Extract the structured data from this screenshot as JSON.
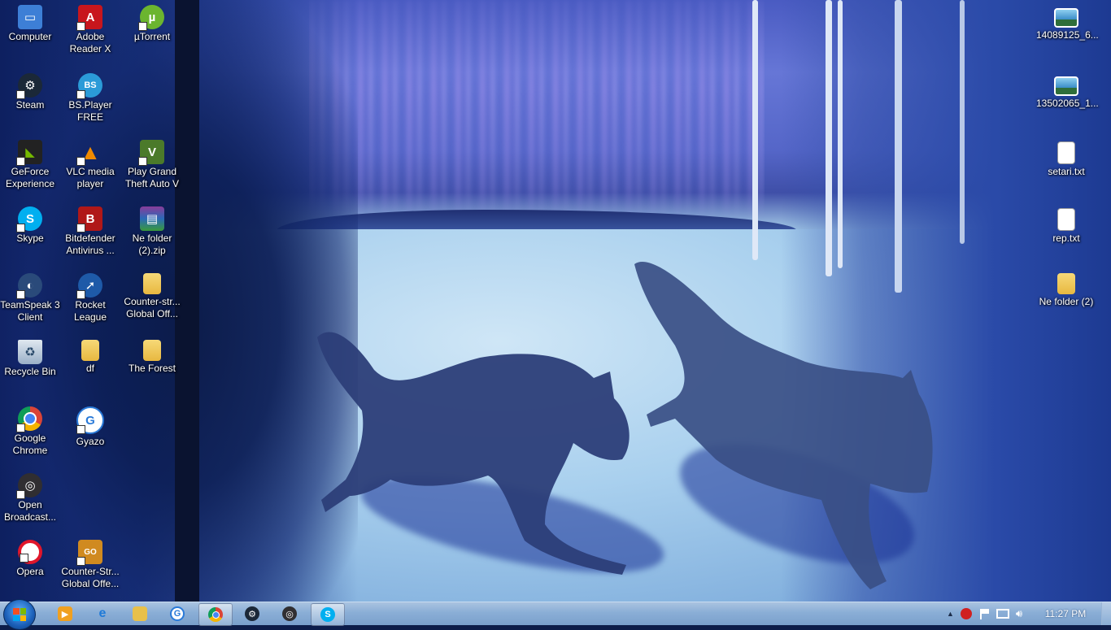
{
  "desktop": {
    "icons_left": [
      {
        "label": "Computer",
        "icon": "computer-icon",
        "color": "#3d7fd6"
      },
      {
        "label": "Adobe\nReader X",
        "icon": "adobe-reader-icon",
        "color": "#c8161d"
      },
      {
        "label": "µTorrent",
        "icon": "utorrent-icon",
        "color": "#6bb52f"
      },
      {
        "label": "Steam",
        "icon": "steam-icon",
        "color": "#1b2838"
      },
      {
        "label": "BS.Player\nFREE",
        "icon": "bsplayer-icon",
        "color": "#2b9bd8"
      },
      {
        "label": "GeForce\nExperience",
        "icon": "geforce-icon",
        "color": "#76b900"
      },
      {
        "label": "VLC media\nplayer",
        "icon": "vlc-icon",
        "color": "#f08a00"
      },
      {
        "label": "Play Grand\nTheft Auto V",
        "icon": "gta-icon",
        "color": "#4b7a2a"
      },
      {
        "label": "Skype",
        "icon": "skype-icon",
        "color": "#00aff0"
      },
      {
        "label": "Bitdefender\nAntivirus ...",
        "icon": "bitdefender-icon",
        "color": "#b01818"
      },
      {
        "label": "Ne folder\n(2).zip",
        "icon": "winrar-icon",
        "color": "#8a3d9a"
      },
      {
        "label": "TeamSpeak 3\nClient",
        "icon": "teamspeak-icon",
        "color": "#2a4a7a"
      },
      {
        "label": "Rocket\nLeague",
        "icon": "rocket-league-icon",
        "color": "#1e5aa8"
      },
      {
        "label": "Counter-str...\nGlobal Off...",
        "icon": "folder-icon",
        "color": "#f0c850"
      },
      {
        "label": "Recycle Bin",
        "icon": "recycle-bin-icon",
        "color": "#c0d0e0"
      },
      {
        "label": "df",
        "icon": "folder-icon",
        "color": "#f0c850"
      },
      {
        "label": "The Forest",
        "icon": "folder-icon",
        "color": "#f0c850"
      },
      {
        "label": "Google\nChrome",
        "icon": "chrome-icon",
        "color": "#4285f4"
      },
      {
        "label": "Gyazo",
        "icon": "gyazo-icon",
        "color": "#2a7ad8"
      },
      {
        "label": "Open\nBroadcast...",
        "icon": "obs-icon",
        "color": "#302e31"
      },
      {
        "label": "Opera",
        "icon": "opera-icon",
        "color": "#e0162b"
      },
      {
        "label": "Counter-Str...\nGlobal Offe...",
        "icon": "csgo-icon",
        "color": "#d08a20"
      }
    ],
    "icons_right": [
      {
        "label": "14089125_6...",
        "icon": "image-file-icon"
      },
      {
        "label": "13502065_1...",
        "icon": "image-file-icon"
      },
      {
        "label": "setari.txt",
        "icon": "text-file-icon"
      },
      {
        "label": "rep.txt",
        "icon": "text-file-icon"
      },
      {
        "label": "Ne folder (2)",
        "icon": "folder-icon"
      }
    ]
  },
  "taskbar": {
    "pinned": [
      {
        "name": "media-player-icon",
        "color": "#f0a020",
        "active": false
      },
      {
        "name": "internet-explorer-icon",
        "color": "#1e7ad8",
        "active": false
      },
      {
        "name": "file-explorer-icon",
        "color": "#e8c04a",
        "active": false
      },
      {
        "name": "gyazo-taskbar-icon",
        "color": "#2a7ad8",
        "active": false
      },
      {
        "name": "chrome-taskbar-icon",
        "color": "#4285f4",
        "active": true
      },
      {
        "name": "steam-taskbar-icon",
        "color": "#1b2838",
        "active": false
      },
      {
        "name": "obs-taskbar-icon",
        "color": "#302e31",
        "active": false
      },
      {
        "name": "skype-taskbar-icon",
        "color": "#00aff0",
        "active": true
      }
    ],
    "tray_icons": [
      "show-hidden-icons",
      "bitdefender-tray-icon",
      "action-center-flag-icon",
      "network-icon",
      "volume-icon"
    ],
    "clock": "11:27 PM"
  }
}
